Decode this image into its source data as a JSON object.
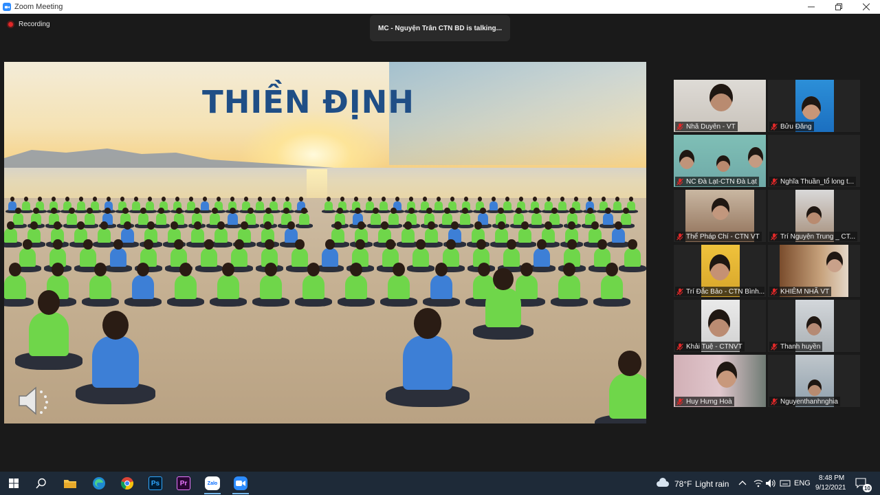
{
  "window": {
    "title": "Zoom Meeting"
  },
  "meeting": {
    "recording_label": "Recording",
    "talking_indicator": "MC - Nguyện Trân CTN BD is talking..."
  },
  "shared_screen": {
    "slide_title": "THIỀN ĐỊNH"
  },
  "participants": [
    {
      "name": "Nhã Duyên - VT",
      "muted": true
    },
    {
      "name": "Bửu Đăng",
      "muted": true
    },
    {
      "name": "NC Đà Lạt-CTN Đà Lạt",
      "muted": true
    },
    {
      "name": "Nghĩa Thuần_tổ long t...",
      "muted": true
    },
    {
      "name": "Thể Pháp Chí - CTN VT",
      "muted": true
    },
    {
      "name": "Trí Nguyện Trung _ CT...",
      "muted": true
    },
    {
      "name": "Trí Đắc Bảo - CTN Bình...",
      "muted": true
    },
    {
      "name": "KHIÊM NHÃ VT",
      "muted": true
    },
    {
      "name": "Khải Tuệ - CTNVT",
      "muted": true
    },
    {
      "name": "Thanh huyền",
      "muted": true
    },
    {
      "name": "Huy Hưng Hoà",
      "muted": true
    },
    {
      "name": "Nguyenthanhnghia",
      "muted": true
    }
  ],
  "taskbar": {
    "apps": [
      "start-icon",
      "search-icon",
      "file-explorer-icon",
      "edge-icon",
      "chrome-icon",
      "photoshop-icon",
      "premiere-icon",
      "zalo-icon",
      "zoom-icon"
    ],
    "photoshop_label": "Ps",
    "premiere_label": "Pr",
    "zalo_label": "Zalo",
    "weather_temp": "78°F",
    "weather_desc": "Light rain",
    "language": "ENG",
    "time": "8:48 PM",
    "date": "9/12/2021",
    "notification_count": "10"
  },
  "colors": {
    "zoom_blue": "#2d8cff",
    "muted_red": "#e02828",
    "slide_title": "#1f4e86",
    "shirt_green": "#6fd64a",
    "shirt_blue": "#3d7fd6"
  }
}
